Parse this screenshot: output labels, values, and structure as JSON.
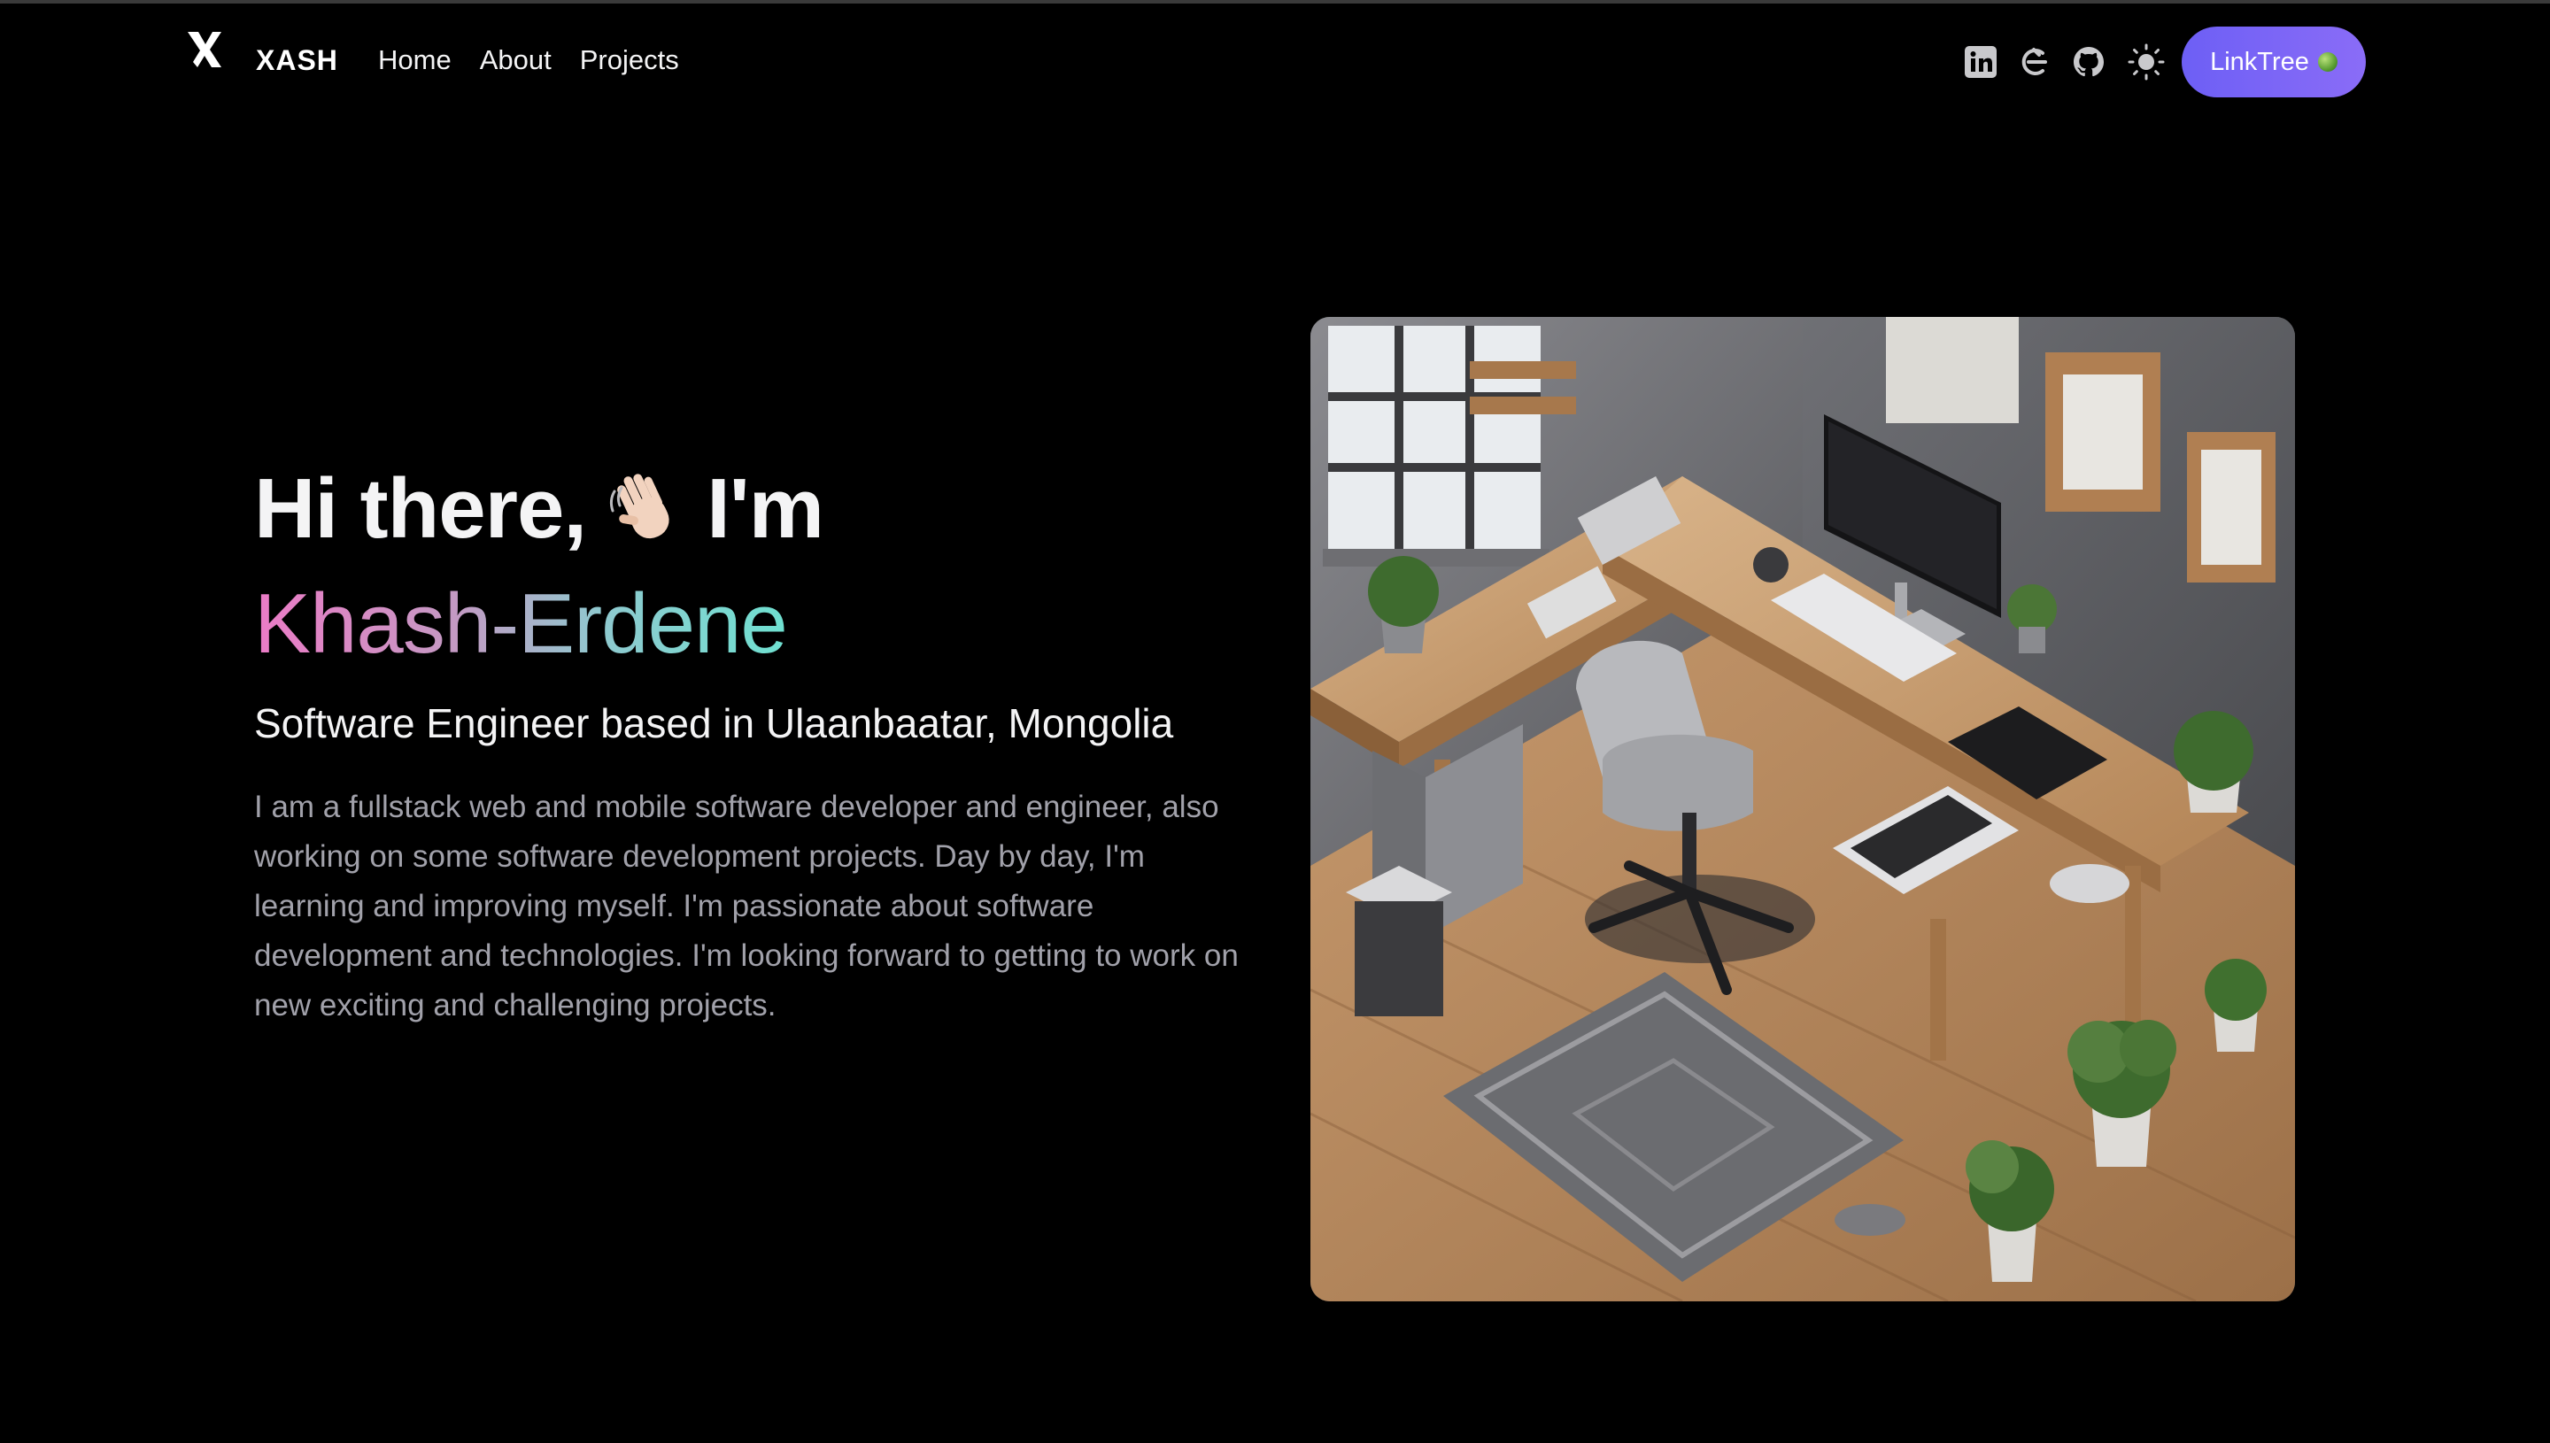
{
  "header": {
    "brand": "XASH",
    "nav": [
      "Home",
      "About",
      "Projects"
    ],
    "social_icons": [
      "linkedin-icon",
      "dev-blog-icon",
      "github-icon",
      "theme-toggle-sun-icon"
    ],
    "linktree_label": "LinkTree",
    "linktree_icon": "globe-icon",
    "accent_color": "#7164f6"
  },
  "hero": {
    "greeting": "Hi there,",
    "greeting_suffix": "I'm",
    "greeting_icon": "waving-hand-icon",
    "name": "Khash-Erdene",
    "subtitle": "Software Engineer based in Ulaanbaatar, Mongolia",
    "bio": "I am a fullstack web and mobile software developer and engineer, also working on some software development projects. Day by day, I'm learning and improving myself. I'm passionate about software development and technologies. I'm looking forward to getting to work on new exciting and challenging projects.",
    "image_icon": "isometric-workspace-illustration",
    "name_gradient": [
      "#ec7bc6",
      "#6fe0d0"
    ]
  }
}
